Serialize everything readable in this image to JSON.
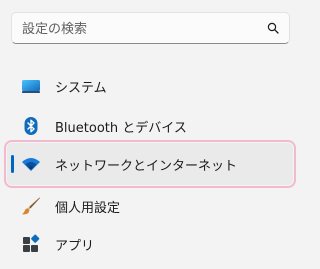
{
  "search": {
    "placeholder": "設定の検索",
    "icon": "search-icon"
  },
  "nav": {
    "items": [
      {
        "label": "システム",
        "icon": "system-display-icon",
        "selected": false
      },
      {
        "label": "Bluetooth とデバイス",
        "icon": "bluetooth-icon",
        "selected": false
      },
      {
        "label": "ネットワークとインターネット",
        "icon": "wifi-icon",
        "selected": true
      },
      {
        "label": "個人用設定",
        "icon": "paintbrush-icon",
        "selected": false
      },
      {
        "label": "アプリ",
        "icon": "apps-icon",
        "selected": false
      }
    ]
  },
  "colors": {
    "accent": "#0067c0",
    "selection_highlight": "#f3b9d0",
    "background": "#f3f3f3"
  }
}
